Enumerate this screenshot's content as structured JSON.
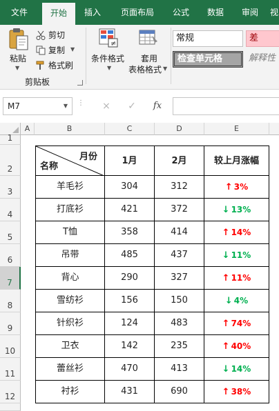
{
  "tabs": [
    "文件",
    "开始",
    "插入",
    "页面布局",
    "公式",
    "数据",
    "审阅",
    "视"
  ],
  "active_tab_index": 1,
  "ribbon": {
    "clipboard": {
      "paste_label": "粘贴",
      "cut_label": "剪切",
      "copy_label": "复制",
      "format_painter_label": "格式刷",
      "group_label": "剪贴板"
    },
    "styles": {
      "conditional_format_label": "条件格式",
      "table_format_line1": "套用",
      "table_format_line2": "表格格式",
      "normal_label": "常规",
      "bad_label": "差",
      "check_cell_label": "检查单元格",
      "explanatory_label": "解释性"
    }
  },
  "formula_bar": {
    "name_box": "M7",
    "cancel_icon": "×",
    "enter_icon": "✓",
    "fx_label": "fx",
    "formula": ""
  },
  "grid": {
    "columns": [
      "A",
      "B",
      "C",
      "D",
      "E"
    ],
    "rows": [
      "1",
      "2",
      "3",
      "4",
      "5",
      "6",
      "7",
      "8",
      "9",
      "10",
      "11",
      "12"
    ],
    "selected_row": "7"
  },
  "table": {
    "diag_top": "月份",
    "diag_bottom": "名称",
    "headers": [
      "1月",
      "2月",
      "较上月涨幅"
    ],
    "rows": [
      {
        "name": "羊毛衫",
        "jan": "304",
        "feb": "312",
        "change": "3%",
        "direction": "up"
      },
      {
        "name": "打底衫",
        "jan": "421",
        "feb": "372",
        "change": "13%",
        "direction": "down"
      },
      {
        "name": "T恤",
        "jan": "358",
        "feb": "414",
        "change": "14%",
        "direction": "up"
      },
      {
        "name": "吊带",
        "jan": "485",
        "feb": "437",
        "change": "11%",
        "direction": "down"
      },
      {
        "name": "背心",
        "jan": "290",
        "feb": "327",
        "change": "11%",
        "direction": "up"
      },
      {
        "name": "雪纺衫",
        "jan": "156",
        "feb": "150",
        "change": "4%",
        "direction": "down"
      },
      {
        "name": "针织衫",
        "jan": "124",
        "feb": "483",
        "change": "74%",
        "direction": "up"
      },
      {
        "name": "卫衣",
        "jan": "142",
        "feb": "235",
        "change": "40%",
        "direction": "up"
      },
      {
        "name": "蕾丝衫",
        "jan": "470",
        "feb": "413",
        "change": "14%",
        "direction": "down"
      },
      {
        "name": "衬衫",
        "jan": "431",
        "feb": "690",
        "change": "38%",
        "direction": "up"
      }
    ]
  },
  "colors": {
    "brand": "#217346",
    "up": "#ff0000",
    "down": "#00b050",
    "bad_fill": "#ffc7ce",
    "bad_text": "#9c0006",
    "check_fill": "#a5a5a5"
  }
}
